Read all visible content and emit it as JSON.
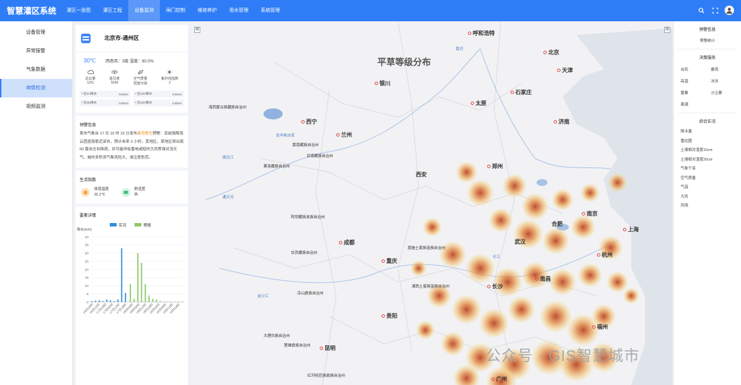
{
  "app": {
    "title": "智慧灌区系统"
  },
  "nav": [
    {
      "label": "灌区一张图"
    },
    {
      "label": "灌区工程"
    },
    {
      "label": "设备监测"
    },
    {
      "label": "闸门控制"
    },
    {
      "label": "维修养护"
    },
    {
      "label": "用水管理"
    },
    {
      "label": "系统管理"
    }
  ],
  "left_menu": [
    {
      "label": "设备管理"
    },
    {
      "label": "异常报警"
    },
    {
      "label": "气象数据"
    },
    {
      "label": "墒情检测"
    },
    {
      "label": "视频监测"
    }
  ],
  "panel": {
    "location": "北京市-通州区",
    "temperature": "30℃",
    "weather_detail": "西南风：3级 湿度：60.0%",
    "metrics": [
      {
        "name": "总云量",
        "value": "12%",
        "icon": "cloud-icon"
      },
      {
        "name": "能见度",
        "value": "5KM",
        "icon": "eye-icon"
      },
      {
        "name": "空气质量",
        "value": "轻度污染",
        "icon": "leaf-icon"
      },
      {
        "name": "紫外线指数",
        "value": "2",
        "icon": "sun-icon"
      }
    ],
    "rain": [
      {
        "label": "• 近1H降水",
        "value": "0.5mm"
      },
      {
        "label": "• 近12H降水",
        "value": "0.5mm"
      },
      {
        "label": "• 近3H降水",
        "value": "0.8mm"
      },
      {
        "label": "• 近24H降水",
        "value": "0.8mm"
      }
    ],
    "warning_title": "预警信息",
    "warning_pre": "某市气象台 17 日 15 时 15 分发布",
    "warning_level": "暴雨橙色",
    "warning_post": "预警：目前强降雨云团逐渐靠近该市，预计未来 3 小时，其地区，某地区将出现 50 毫米左右降雨，并可能伴有雷电或短时大风等强对流天气。城市多积涝气象风险大，请注意防范。",
    "life_title": "生活指数",
    "life": [
      {
        "name": "体感温度",
        "value": "35.2℃"
      },
      {
        "name": "舒适度",
        "value": "热"
      }
    ],
    "chart_title": "要素详情"
  },
  "chart_data": {
    "type": "bar",
    "ylabel": "降水(mm)",
    "ylim": [
      0,
      40
    ],
    "yticks": [
      "0",
      "5",
      "10",
      "15",
      "20",
      "25",
      "30",
      "35",
      "40"
    ],
    "categories": [
      "16日18时",
      "16日21时",
      "17日00时",
      "17日03时",
      "17日06时",
      "17日09时",
      "17日12时",
      "17日15时",
      "17日18时",
      "17日21时",
      "18日00时",
      "18日03时",
      "18日06时",
      "18日09时",
      "18日12时",
      "18日15时",
      "18日18时",
      "18日21时",
      "19日00时",
      "19日03时",
      "19日06时",
      "19日09时",
      "19日12时",
      "19日15时",
      "19日18时"
    ],
    "x_tick_labels": [
      "16日18时",
      "16日21时",
      "17日03时",
      "17日06时",
      "17日12时",
      "17日18时",
      "18日00时",
      "18日06时",
      "18日12时",
      "18日18时",
      "19日00时",
      "19日06时",
      "19日12时",
      "19日18时"
    ],
    "series": [
      {
        "name": "实况",
        "color": "#2f8fdc",
        "values": [
          0.5,
          0.8,
          1.0,
          0.5,
          1.5,
          1.0,
          0.5,
          1.5,
          33,
          5.5,
          0,
          0,
          0,
          0,
          0,
          0,
          0,
          0,
          0,
          0,
          0,
          0,
          0,
          0,
          0
        ]
      },
      {
        "name": "预报",
        "color": "#8cc96b",
        "values": [
          0,
          0,
          0,
          0,
          0,
          0,
          0,
          0,
          0,
          0,
          11,
          2,
          30,
          24,
          11,
          4,
          2,
          1.5,
          0.5,
          0.2,
          0.2,
          0.2,
          0.2,
          0.2,
          0.2
        ]
      }
    ]
  },
  "map": {
    "title": "平草等级分布",
    "cities": [
      {
        "name": "呼和浩特"
      },
      {
        "name": "北京"
      },
      {
        "name": "天津"
      },
      {
        "name": "石家庄"
      },
      {
        "name": "太原"
      },
      {
        "name": "济南"
      },
      {
        "name": "西宁"
      },
      {
        "name": "兰州"
      },
      {
        "name": "银川"
      },
      {
        "name": "郑州"
      },
      {
        "name": "西安"
      },
      {
        "name": "合肥"
      },
      {
        "name": "南京"
      },
      {
        "name": "上海"
      },
      {
        "name": "武汉"
      },
      {
        "name": "杭州"
      },
      {
        "name": "成都"
      },
      {
        "name": "重庆"
      },
      {
        "name": "长沙"
      },
      {
        "name": "南昌"
      },
      {
        "name": "贵阳"
      },
      {
        "name": "昆明"
      },
      {
        "name": "福州"
      },
      {
        "name": "广州"
      }
    ],
    "labels": [
      "海西蒙古族藏族自治州",
      "黄南藏族自治州",
      "甘南藏族自治州",
      "果洛藏族自治州",
      "阿坝藏族羌族自治州",
      "甘孜藏族自治州",
      "凉山彝族自治州",
      "大理白族自治州",
      "楚雄彝族自治州",
      "红河哈尼族彝族自治州",
      "恩施土家族苗族自治州",
      "湘西土家族苗族自治州"
    ],
    "rivers": [
      "黄河",
      "长江",
      "金沙江",
      "通天河",
      "澜沧江",
      "龙羊峡水库"
    ]
  },
  "right_panel": {
    "warning_title": "预警信息",
    "warning_item": "预警统计",
    "decision_title": "决策服务",
    "decision_items": [
      "台风",
      "暴雨",
      "高温",
      "冰冻",
      "雷暴",
      "沙尘暴",
      "寒潮"
    ],
    "situation_title": "综合实况",
    "situation_items": [
      "降水量",
      "雷达图",
      "土壤相对湿度10cm",
      "土壤相对湿度20cm",
      "气象干旱",
      "空气质量",
      "气温",
      "大风",
      "风场"
    ]
  },
  "watermark": "公众号 · GIS智慧城市"
}
